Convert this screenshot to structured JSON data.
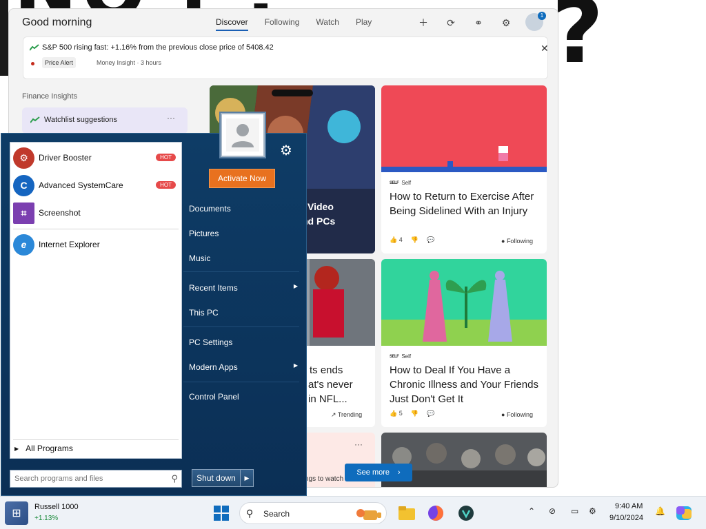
{
  "widgets": {
    "greeting": "Good morning",
    "tabs": [
      {
        "label": "Discover",
        "active": true
      },
      {
        "label": "Following",
        "active": false
      },
      {
        "label": "Watch",
        "active": false
      },
      {
        "label": "Play",
        "active": false
      }
    ],
    "header_icons": [
      "plus-icon",
      "refresh-icon",
      "share-icon",
      "gear-icon"
    ],
    "notification_count": "1",
    "alert": {
      "text": "S&P 500 rising fast: +1.16% from the previous close price of 5408.42",
      "tag": "Price Alert",
      "source": "Money Insight · 3 hours",
      "close": "✕"
    },
    "finance_title": "Finance Insights",
    "watchlist": {
      "label": "Watchlist suggestions",
      "more": "···"
    },
    "cards": {
      "game": {
        "title_line1": "Video",
        "title_line2": "nd PCs"
      },
      "exercise": {
        "source": "Self",
        "title": "How to Return to Exercise After Being Sidelined With an Injury",
        "likes": "4",
        "follow": "Following"
      },
      "nfl": {
        "title_l1": "ts ends",
        "title_l2": "at's never",
        "title_l3": "in NFL...",
        "tag": "Trending"
      },
      "illness": {
        "source": "Self",
        "title": "How to Deal If You Have a Chronic Illness and Your Friends Just Don't Get It",
        "likes": "5",
        "follow": "Following"
      },
      "bottom_left": {
        "text": "ngs to watch for",
        "more": "···"
      }
    },
    "see_more": "See more"
  },
  "start_menu": {
    "apps": [
      {
        "label": "Driver Booster",
        "badge": "HOT",
        "color": "#c0392b"
      },
      {
        "label": "Advanced SystemCare",
        "badge": "HOT",
        "color": "#1565c0"
      },
      {
        "label": "Screenshot",
        "badge": "",
        "color": "#7b3fb0"
      },
      {
        "label": "Internet Explorer",
        "badge": "",
        "color": "#2b88d8"
      }
    ],
    "all_programs": "All Programs",
    "search_placeholder": "Search programs and files",
    "activate": "Activate Now",
    "right_items": [
      {
        "label": "Documents",
        "arrow": false
      },
      {
        "label": "Pictures",
        "arrow": false
      },
      {
        "label": "Music",
        "arrow": false
      },
      {
        "label": "Recent Items",
        "arrow": true
      },
      {
        "label": "This PC",
        "arrow": false
      },
      {
        "label": "PC Settings",
        "arrow": false
      },
      {
        "label": "Modern Apps",
        "arrow": true
      },
      {
        "label": "Control Panel",
        "arrow": false
      }
    ],
    "shutdown": "Shut down"
  },
  "taskbar": {
    "stock_name": "Russell 1000",
    "stock_change": "+1.13%",
    "search_label": "Search",
    "time": "9:40 AM",
    "date": "9/10/2024",
    "accent": "#0f6cbd"
  }
}
